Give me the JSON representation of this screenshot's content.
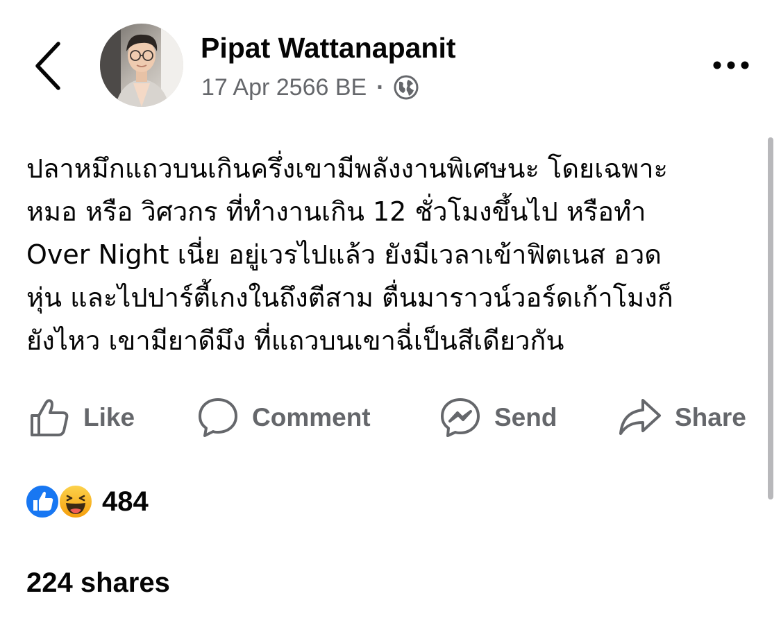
{
  "header": {
    "back_icon": "chevron-left-icon",
    "author_name": "Pipat Wattanapanit",
    "timestamp": "17 Apr 2566 BE",
    "separator": "·",
    "privacy_icon": "globe-icon",
    "more_icon": "more-horizontal-icon"
  },
  "post": {
    "text": "ปลาหมึกแถวบนเกินครึ่งเขามีพลังงานพิเศษนะ โดยเฉพาะ\nหมอ หรือ วิศวกร ที่ทำงานเกิน 12 ชั่วโมงขึ้นไป หรือทำ\nOver Night เนี่ย อยู่เวรไปแล้ว ยังมีเวลาเข้าฟิตเนส อวด\nหุ่น และไปปาร์ตี้เกงในถึงตีสาม ตื่นมาราวน์วอร์ดเก้าโมงก็\nยังไหว เขามียาดีมึง ที่แถวบนเขาฉี่เป็นสีเดียวกัน"
  },
  "actions": {
    "like_label": "Like",
    "comment_label": "Comment",
    "send_label": "Send",
    "share_label": "Share"
  },
  "reactions": {
    "types": [
      "like-reaction-icon",
      "haha-reaction-icon"
    ],
    "count": "484",
    "like_color": "#1877f2",
    "haha_color": "#f7b125"
  },
  "shares_text": "224 shares",
  "colors": {
    "primary_text": "#050505",
    "secondary_text": "#65676b"
  }
}
